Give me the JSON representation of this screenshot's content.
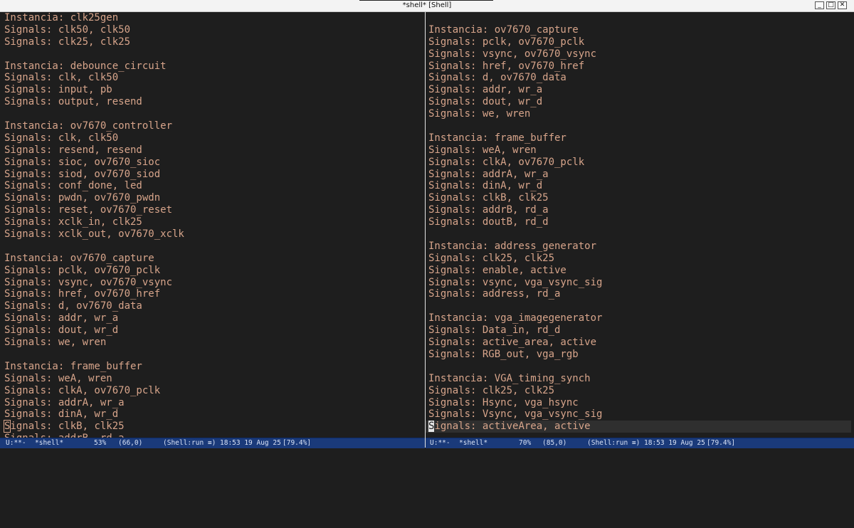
{
  "window": {
    "title": "*shell* [Shell]",
    "buttons": {
      "minimize": "_",
      "maximize": "□",
      "close": "✕"
    }
  },
  "left_pane": {
    "lines": [
      "Instancia: clk25gen",
      "Signals: clk50, clk50",
      "Signals: clk25, clk25",
      "",
      "Instancia: debounce_circuit",
      "Signals: clk, clk50",
      "Signals: input, pb",
      "Signals: output, resend",
      "",
      "Instancia: ov7670_controller",
      "Signals: clk, clk50",
      "Signals: resend, resend",
      "Signals: sioc, ov7670_sioc",
      "Signals: siod, ov7670_siod",
      "Signals: conf_done, led",
      "Signals: pwdn, ov7670_pwdn",
      "Signals: reset, ov7670_reset",
      "Signals: xclk_in, clk25",
      "Signals: xclk_out, ov7670_xclk",
      "",
      "Instancia: ov7670_capture",
      "Signals: pclk, ov7670_pclk",
      "Signals: vsync, ov7670_vsync",
      "Signals: href, ov7670_href",
      "Signals: d, ov7670_data",
      "Signals: addr, wr_a",
      "Signals: dout, wr_d",
      "Signals: we, wren",
      "",
      "Instancia: frame_buffer",
      "Signals: weA, wren",
      "Signals: clkA, ov7670_pclk",
      "Signals: addrA, wr_a",
      "Signals: dinA, wr_d",
      "Signals: clkB, clk25",
      "Signals: addrB, rd_a"
    ],
    "modeline": {
      "status": "U:**-",
      "buffer": "*shell*",
      "percent": "53%",
      "position": "(66,0)",
      "mode": "(Shell:run ≡)",
      "time": "18:53 19 Aug 25",
      "load": "[79.4%]"
    }
  },
  "right_pane": {
    "lines": [
      "",
      "Instancia: ov7670_capture",
      "Signals: pclk, ov7670_pclk",
      "Signals: vsync, ov7670_vsync",
      "Signals: href, ov7670_href",
      "Signals: d, ov7670_data",
      "Signals: addr, wr_a",
      "Signals: dout, wr_d",
      "Signals: we, wren",
      "",
      "Instancia: frame_buffer",
      "Signals: weA, wren",
      "Signals: clkA, ov7670_pclk",
      "Signals: addrA, wr_a",
      "Signals: dinA, wr_d",
      "Signals: clkB, clk25",
      "Signals: addrB, rd_a",
      "Signals: doutB, rd_d",
      "",
      "Instancia: address_generator",
      "Signals: clk25, clk25",
      "Signals: enable, active",
      "Signals: vsync, vga_vsync_sig",
      "Signals: address, rd_a",
      "",
      "Instancia: vga_imagegenerator",
      "Signals: Data_in, rd_d",
      "Signals: active_area, active",
      "Signals: RGB_out, vga_rgb",
      "",
      "Instancia: VGA_timing_synch",
      "Signals: clk25, clk25",
      "Signals: Hsync, vga_hsync",
      "Signals: Vsync, vga_vsync_sig",
      "Signals: activeArea, active"
    ],
    "modeline": {
      "status": "U:**-",
      "buffer": "*shell*",
      "percent": "70%",
      "position": "(85,0)",
      "mode": "(Shell:run ≡)",
      "time": "18:53 19 Aug 25",
      "load": "[79.4%]"
    }
  },
  "colors": {
    "text": "#d8a58b",
    "background": "#1e1e1e",
    "modeline_bg": "#1a3a7a",
    "modeline_fg": "#d8e2f6",
    "current_line": "#2f2f2f"
  }
}
